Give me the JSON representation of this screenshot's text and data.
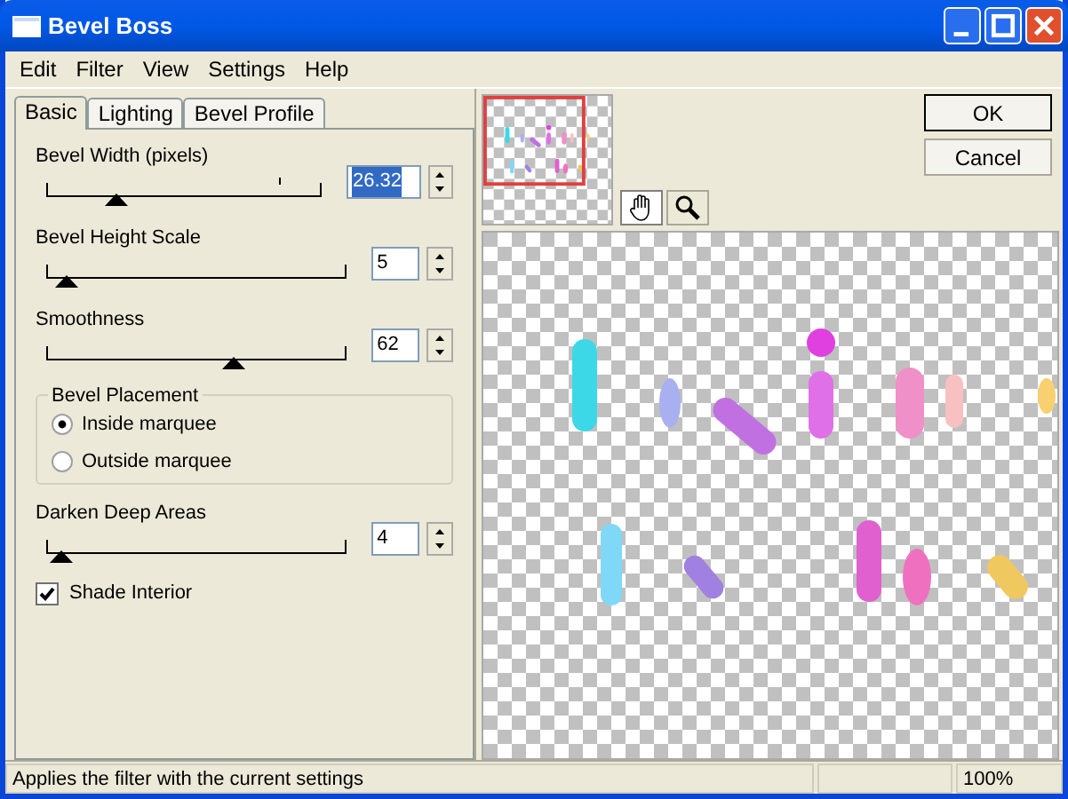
{
  "window": {
    "title": "Bevel Boss"
  },
  "menu": [
    "Edit",
    "Filter",
    "View",
    "Settings",
    "Help"
  ],
  "tabs": [
    {
      "label": "Basic",
      "selected": true
    },
    {
      "label": "Lighting",
      "selected": false
    },
    {
      "label": "Bevel Profile",
      "selected": false
    }
  ],
  "sliders": [
    {
      "label": "Bevel Width (pixels)",
      "value": "26.32",
      "level": 0.25,
      "value_selected": true
    },
    {
      "label": "Bevel Height Scale",
      "value": "5",
      "level": 0.06,
      "value_selected": false
    },
    {
      "label": "Smoothness",
      "value": "62",
      "level": 0.62,
      "value_selected": false
    }
  ],
  "bevel_placement": {
    "title": "Bevel Placement",
    "options": [
      {
        "label": "Inside marquee",
        "selected": true
      },
      {
        "label": "Outside marquee",
        "selected": false
      }
    ]
  },
  "darken": {
    "label": "Darken Deep Areas",
    "value": "4",
    "level": 0.04,
    "value_selected": false
  },
  "shade_interior": {
    "label": "Shade Interior",
    "checked": true
  },
  "tools": [
    {
      "kind": "hand",
      "selected": true
    },
    {
      "kind": "zoom",
      "selected": false
    }
  ],
  "buttons": [
    "OK",
    "Cancel"
  ],
  "status_bar": {
    "message": "Applies the filter with the current settings",
    "zoom": "100%"
  }
}
